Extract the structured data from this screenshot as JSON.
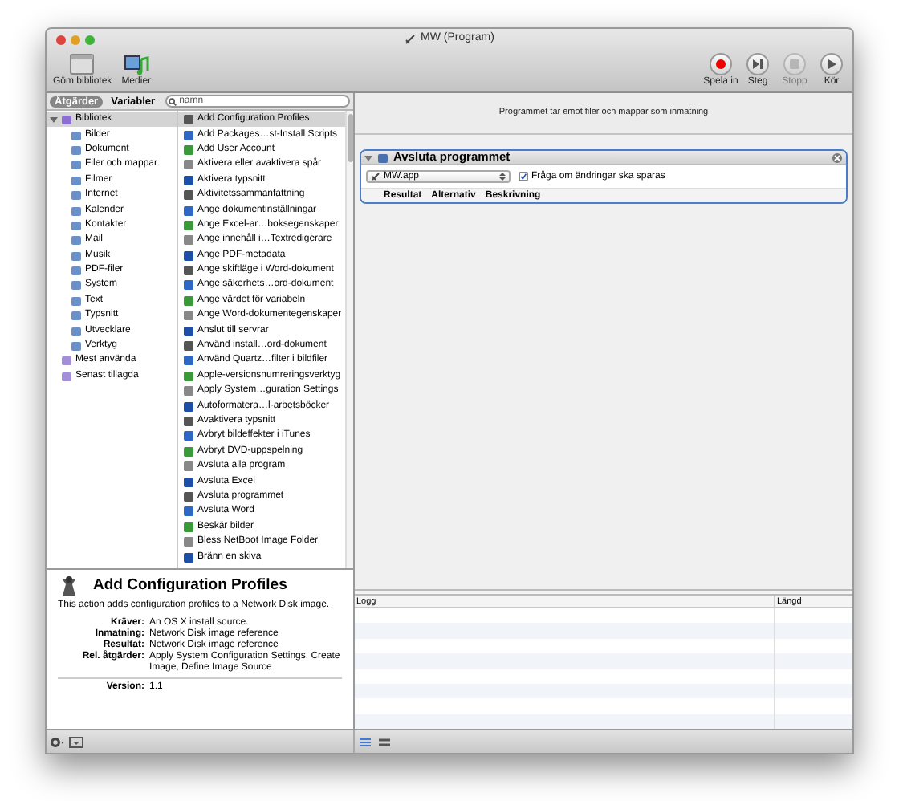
{
  "window": {
    "title": "MW (Program)"
  },
  "toolbar_left": [
    {
      "kind": "library",
      "label": "Göm bibliotek"
    },
    {
      "kind": "media",
      "label": "Medier"
    }
  ],
  "toolbar_right": [
    {
      "kind": "record",
      "label": "Spela in",
      "disabled": false
    },
    {
      "kind": "step",
      "label": "Steg",
      "disabled": false
    },
    {
      "kind": "stop",
      "label": "Stopp",
      "disabled": true
    },
    {
      "kind": "run",
      "label": "Kör",
      "disabled": false
    }
  ],
  "library_tabs": [
    {
      "label": "Åtgärder",
      "selected": true
    },
    {
      "label": "Variabler",
      "selected": false
    }
  ],
  "search": {
    "placeholder": "namn"
  },
  "library": [
    {
      "label": "Bibliotek",
      "selected": true,
      "expanded": true,
      "children": [
        {
          "label": "Bilder",
          "selected": false
        },
        {
          "label": "Dokument",
          "selected": false
        },
        {
          "label": "Filer och mappar",
          "selected": false
        },
        {
          "label": "Filmer",
          "selected": false
        },
        {
          "label": "Internet",
          "selected": false
        },
        {
          "label": "Kalender",
          "selected": false
        },
        {
          "label": "Kontakter",
          "selected": false
        },
        {
          "label": "Mail",
          "selected": false
        },
        {
          "label": "Musik",
          "selected": false
        },
        {
          "label": "PDF-filer",
          "selected": false
        },
        {
          "label": "System",
          "selected": false
        },
        {
          "label": "Text",
          "selected": false
        },
        {
          "label": "Typsnitt",
          "selected": false
        },
        {
          "label": "Utvecklare",
          "selected": false
        },
        {
          "label": "Verktyg",
          "selected": false
        }
      ]
    },
    {
      "label": "Mest använda",
      "selected": false
    },
    {
      "label": "Senast tillagda",
      "selected": false
    }
  ],
  "actions": [
    {
      "label": "Add Configuration Profiles",
      "selected": true
    },
    {
      "label": "Add Packages…st-Install Scripts",
      "selected": false
    },
    {
      "label": "Add User Account",
      "selected": false
    },
    {
      "label": "Aktivera eller avaktivera spår",
      "selected": false
    },
    {
      "label": "Aktivera typsnitt",
      "selected": false
    },
    {
      "label": "Aktivitetssammanfattning",
      "selected": false
    },
    {
      "label": "Ange dokumentinställningar",
      "selected": false
    },
    {
      "label": "Ange Excel-ar…boksegenskaper",
      "selected": false
    },
    {
      "label": "Ange innehåll i…Textredigerare",
      "selected": false
    },
    {
      "label": "Ange PDF-metadata",
      "selected": false
    },
    {
      "label": "Ange skiftläge i Word-dokument",
      "selected": false
    },
    {
      "label": "Ange säkerhets…ord-dokument",
      "selected": false
    },
    {
      "label": "Ange värdet för variabeln",
      "selected": false
    },
    {
      "label": "Ange Word-dokumentegenskaper",
      "selected": false
    },
    {
      "label": "Anslut till servrar",
      "selected": false
    },
    {
      "label": "Använd install…ord-dokument",
      "selected": false
    },
    {
      "label": "Använd Quartz…filter i bildfiler",
      "selected": false
    },
    {
      "label": "Apple-versionsnumreringsverktyg",
      "selected": false
    },
    {
      "label": "Apply System…guration Settings",
      "selected": false
    },
    {
      "label": "Autoformatera…l-arbetsböcker",
      "selected": false
    },
    {
      "label": "Avaktivera typsnitt",
      "selected": false
    },
    {
      "label": "Avbryt bildeffekter i iTunes",
      "selected": false
    },
    {
      "label": "Avbryt DVD-uppspelning",
      "selected": false
    },
    {
      "label": "Avsluta alla program",
      "selected": false
    },
    {
      "label": "Avsluta Excel",
      "selected": false
    },
    {
      "label": "Avsluta programmet",
      "selected": false
    },
    {
      "label": "Avsluta Word",
      "selected": false
    },
    {
      "label": "Beskär bilder",
      "selected": false
    },
    {
      "label": "Bless NetBoot Image Folder",
      "selected": false
    },
    {
      "label": "Bränn en skiva",
      "selected": false
    }
  ],
  "description": {
    "title": "Add Configuration Profiles",
    "text": "This action adds configuration profiles to a Network Disk image.",
    "fields": [
      {
        "label": "Kräver:",
        "value": "An OS X install source."
      },
      {
        "label": "Inmatning:",
        "value": "Network Disk image reference"
      },
      {
        "label": "Resultat:",
        "value": "Network Disk image reference"
      },
      {
        "label": "Rel. åtgärder:",
        "value": "Apply System Configuration Settings, Create Image, Define Image Source"
      }
    ],
    "version": {
      "label": "Version:",
      "value": "1.1"
    }
  },
  "workflow": {
    "input_note": "Programmet tar emot filer och mappar som inmatning",
    "action": {
      "title": "Avsluta programmet",
      "expanded": true,
      "app": "MW.app",
      "ask_save": {
        "label": "Fråga om ändringar ska sparas",
        "checked": true
      },
      "tabs": [
        "Resultat",
        "Alternativ",
        "Beskrivning"
      ]
    }
  },
  "log": {
    "columns": [
      "Logg",
      "Längd"
    ]
  }
}
